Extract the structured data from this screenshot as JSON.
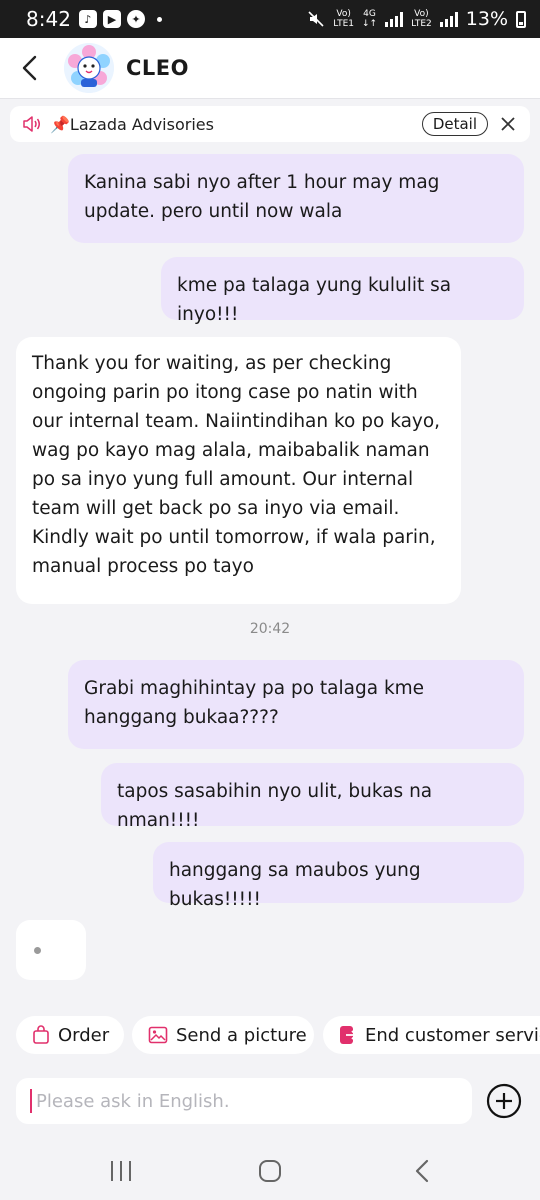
{
  "status_bar": {
    "time": "8:42",
    "net1_top": "Vo)",
    "net1_bottom": "LTE1",
    "net2_top": "Vo)",
    "net2_bottom": "LTE2",
    "gen": "4G",
    "battery": "13%"
  },
  "header": {
    "shop_name": "CLEO"
  },
  "advisory": {
    "text": "📌Lazada Advisories",
    "detail_label": "Detail"
  },
  "messages": [
    {
      "side": "me",
      "text": "Kanina sabi nyo after 1 hour may mag update. pero until now wala"
    },
    {
      "side": "me",
      "text": "kme pa talaga yung kululit sa inyo!!!"
    },
    {
      "side": "them",
      "text": "Thank you for waiting, as per checking ongoing parin po itong case po natin with our internal team. Naiintindihan ko po kayo, wag po kayo mag alala, maibabalik naman po sa inyo yung full amount. Our internal team will get back po sa inyo via email. Kindly wait po until tomorrow, if wala parin, manual process po tayo"
    },
    {
      "side": "me",
      "text": "Grabi maghihintay pa po talaga kme hanggang bukaa????"
    },
    {
      "side": "me",
      "text": "tapos sasabihin nyo ulit, bukas na nman!!!!"
    },
    {
      "side": "me",
      "text": "hanggang sa maubos yung bukas!!!!!"
    }
  ],
  "timestamp": "20:42",
  "quick_actions": [
    {
      "label": "Order",
      "icon": "shopping-bag-icon"
    },
    {
      "label": "Send a picture",
      "icon": "image-icon"
    },
    {
      "label": "End customer service",
      "icon": "exit-icon"
    }
  ],
  "input": {
    "placeholder": "Please ask in English.",
    "value": ""
  },
  "colors": {
    "accent": "#e1306c",
    "my_bubble": "#ece4fb",
    "their_bubble": "#ffffff",
    "background": "#f3f3f6"
  }
}
